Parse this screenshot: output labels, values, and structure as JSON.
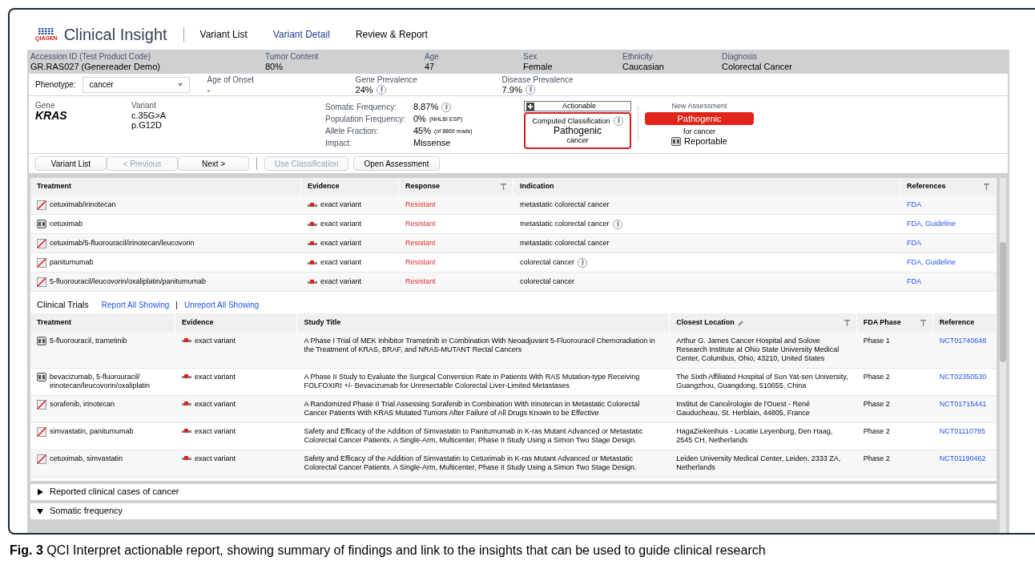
{
  "app": {
    "logo_text": "Clinical Insight",
    "brand": "QIAGEN"
  },
  "tabs": [
    {
      "label": "Variant List",
      "selected": false
    },
    {
      "label": "Variant Detail",
      "selected": true
    },
    {
      "label": "Review & Report",
      "selected": false
    }
  ],
  "case_bar": [
    {
      "label": "Accession ID (Test Product Code)",
      "value": "GR.RAS027  (Genereader Demo)"
    },
    {
      "label": "Tumor Content",
      "value": "80%"
    },
    {
      "label": "Age",
      "value": "47"
    },
    {
      "label": "Sex",
      "value": "Female"
    },
    {
      "label": "Ethnicity",
      "value": "Caucasian"
    },
    {
      "label": "Diagnosis",
      "value": "Colorectal Cancer"
    }
  ],
  "phenotype": {
    "label": "Phenotype:",
    "value": "cancer"
  },
  "phenotype_stats": [
    {
      "label": "Age of Onset",
      "value": "-",
      "info": false
    },
    {
      "label": "Gene Prevalence",
      "value": "24%",
      "info": true
    },
    {
      "label": "Disease Prevalence",
      "value": "7.9%",
      "info": true
    }
  ],
  "gene": {
    "label": "Gene",
    "value": "KRAS"
  },
  "variant": {
    "label": "Variant",
    "lines": [
      "c.35G>A",
      "p.G12D"
    ]
  },
  "frequencies": [
    {
      "label": "Somatic Frequency:",
      "value": "8.87%",
      "info": true
    },
    {
      "label": "Population Frequency:",
      "value": "0%",
      "note": "(NHLBI ESP)",
      "info": false
    },
    {
      "label": "Allele Fraction:",
      "value": "45%",
      "note": "(of 8869 reads)",
      "info": false
    },
    {
      "label": "Impact:",
      "value": "Missense",
      "info": false
    }
  ],
  "actionable": {
    "label": "Actionable"
  },
  "computed": {
    "label": "Computed Classification",
    "value": "Pathogenic",
    "context": "cancer"
  },
  "assessment": {
    "label": "New Assessment",
    "value": "Pathogenic",
    "context": "for cancer",
    "report": "Reportable"
  },
  "nav_buttons": [
    {
      "label": "Variant List",
      "disabled": false
    },
    {
      "label": "< Previous",
      "disabled": true
    },
    {
      "label": "Next >",
      "disabled": false
    }
  ],
  "action_buttons": [
    {
      "label": "Use Classification",
      "disabled": true
    },
    {
      "label": "Open Assessment",
      "disabled": false
    }
  ],
  "treatments": {
    "columns": [
      "Treatment",
      "Evidence",
      "Response",
      "Indication",
      "References"
    ],
    "rows": [
      {
        "kind": "crossed",
        "treatment": "cetuximab/irinotecan",
        "evidence": "exact variant",
        "response": "Resistant",
        "indication": "metastatic colorectal cancer",
        "info": false,
        "references": "FDA"
      },
      {
        "kind": "list",
        "treatment": "cetuximab",
        "evidence": "exact variant",
        "response": "Resistant",
        "indication": "metastatic colorectal cancer",
        "info": true,
        "references": "FDA, Guideline"
      },
      {
        "kind": "crossed",
        "treatment": "cetuximab/5-fluorouracil/irinotecan/leucovorin",
        "evidence": "exact variant",
        "response": "Resistant",
        "indication": "metastatic colorectal cancer",
        "info": false,
        "references": "FDA"
      },
      {
        "kind": "crossed",
        "treatment": "panitumumab",
        "evidence": "exact variant",
        "response": "Resistant",
        "indication": "colorectal cancer",
        "info": true,
        "references": "FDA, Guideline"
      },
      {
        "kind": "crossed",
        "treatment": "5-fluorouracil/leucovorin/oxaliplatin/panitumumab",
        "evidence": "exact variant",
        "response": "Resistant",
        "indication": "colorectal cancer",
        "info": false,
        "references": "FDA"
      }
    ]
  },
  "trials": {
    "title": "Clinical Trials",
    "links": [
      "Report All Showing",
      "Unreport All Showing"
    ],
    "separator": "|",
    "columns": [
      "Treatment",
      "Evidence",
      "Study Title",
      "Closest Location",
      "FDA Phase",
      "Reference"
    ],
    "rows": [
      {
        "kind": "list",
        "treatment": "5-fluorouracil, trametinib",
        "evidence": "exact variant",
        "title": "A Phase I Trial of MEK Inhibitor Trametinib in Combination With Neoadjuvant 5-Fluorouracil Chemoradiation in the Treatment of KRAS, BRAF, and NRAS-MUTANT Rectal Cancers",
        "location": "Arthur G. James Cancer Hospital and Solove Research Institute at Ohio State University Medical Center, Columbus, Ohio, 43210, United States",
        "phase": "Phase 1",
        "reference": "NCT01740648"
      },
      {
        "kind": "list",
        "treatment": "bevacizumab, 5-fluorouracil/ irinotecan/leucovorin/oxaliplatin",
        "evidence": "exact variant",
        "title": "A Phase II Study to Evaluate the Surgical Conversion Rate in Patients With RAS Mutation-type Receiving FOLFOXIRI +/- Bevacizumab for Unresectable Colorectal Liver-Limited Metastases",
        "location": "The Sixth Affiliated Hospital of Sun Yat-sen University, Guangzhou, Guangdong, 510655, China",
        "phase": "Phase 2",
        "reference": "NCT02350530"
      },
      {
        "kind": "crossed",
        "treatment": "sorafenib, irinotecan",
        "evidence": "exact variant",
        "title": "A Randomized Phase II Trial Assessing Sorafenib in Combination With Irinotecan in Metastatic Colorectal Cancer Patients With KRAS Mutated Tumors After Failure of All Drugs Known to be Effective",
        "location": "Institut de Cancérologie de l'Ouest - René Gauducheau, St. Herblain, 44805, France",
        "phase": "Phase 2",
        "reference": "NCT01715441"
      },
      {
        "kind": "crossed",
        "treatment": "simvastatin, panitumumab",
        "evidence": "exact variant",
        "title": "Safety and Efficacy of the Addition of Simvastatin to Panitumumab in K-ras Mutant Advanced or Metastatic Colorectal Cancer Patients. A Single-Arm, Multicenter, Phase II Study Using a Simon Two Stage Design.",
        "location": "HagaZiekenhuis - Locatie Leyenburg, Den Haag, 2545 CH, Netherlands",
        "phase": "Phase 2",
        "reference": "NCT01110785"
      },
      {
        "kind": "crossed",
        "treatment": "cetuximab, simvastatin",
        "evidence": "exact variant",
        "title": "Safety and Efficacy of the Addition of Simvastatin to Cetuximab in K-ras Mutant Advanced or Metastatic Colorectal Cancer Patients. A Single-Arm, Multicenter, Phase II Study Using a Simon Two Stage Design.",
        "location": "Leiden University Medical Center, Leiden, 2333 ZA, Netherlands",
        "phase": "Phase 2",
        "reference": "NCT01190462"
      }
    ]
  },
  "sections": [
    {
      "label": "Reported clinical cases of cancer",
      "expanded": false
    },
    {
      "label": "Somatic frequency",
      "expanded": true
    }
  ],
  "caption": "**Fig. 3** QCI Interpret actionable report, showing summary of findings and link to the insights that can be used to guide clinical research"
}
